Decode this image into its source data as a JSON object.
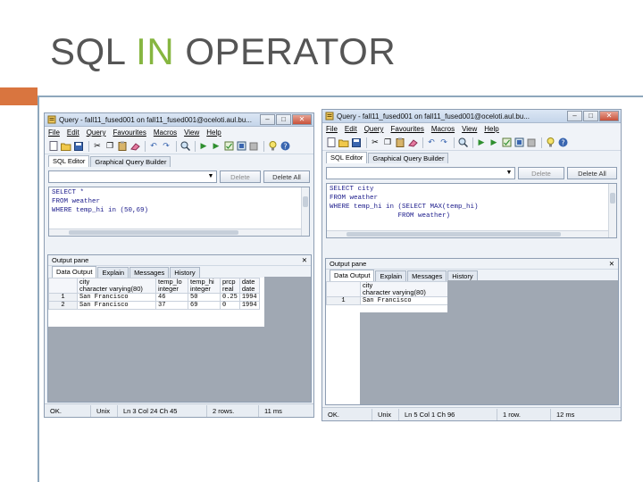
{
  "slide": {
    "title_part1": "SQL ",
    "title_accent": "IN",
    "title_part2": " OPERATOR",
    "accent_color": "#86b640",
    "text_color": "#555555",
    "rule_color": "#d9753f"
  },
  "windows": [
    {
      "title": "Query - fall11_fused001 on fall11_fused001@oceloti.aul.bu...",
      "menu": [
        "File",
        "Edit",
        "Query",
        "Favourites",
        "Macros",
        "View",
        "Help"
      ],
      "tabs": [
        "SQL Editor",
        "Graphical Query Builder"
      ],
      "buttons": {
        "delete": "Delete",
        "delete_all": "Delete All"
      },
      "sql": [
        "SELECT *",
        "FROM weather",
        "WHERE temp_hi in (50,69)"
      ],
      "output_title": "Output pane",
      "output_close": "✕",
      "output_tabs": [
        "Data Output",
        "Explain",
        "Messages",
        "History"
      ],
      "columns": [
        {
          "name": "city",
          "type": "character varying(80)"
        },
        {
          "name": "temp_lo",
          "type": "integer"
        },
        {
          "name": "temp_hi",
          "type": "integer"
        },
        {
          "name": "prcp",
          "type": "real"
        },
        {
          "name": "date",
          "type": "date"
        }
      ],
      "rows": [
        [
          "1",
          "San Francisco",
          "46",
          "50",
          "0.25",
          "1994"
        ],
        [
          "2",
          "San Francisco",
          "37",
          "69",
          "0",
          "1994"
        ]
      ],
      "status": [
        "OK.",
        "Unix",
        "Ln 3 Col 24 Ch 45",
        "2 rows.",
        "11 ms"
      ]
    },
    {
      "title": "Query - fall11_fused001 on fall11_fused001@oceloti.aul.bu...",
      "menu": [
        "File",
        "Edit",
        "Query",
        "Favourites",
        "Macros",
        "View",
        "Help"
      ],
      "tabs": [
        "SQL Editor",
        "Graphical Query Builder"
      ],
      "buttons": {
        "delete": "Delete",
        "delete_all": "Delete All"
      },
      "sql": [
        "SELECT city",
        "FROM weather",
        "WHERE temp_hi in (SELECT MAX(temp_hi)",
        "                 FROM weather)"
      ],
      "output_title": "Output pane",
      "output_close": "✕",
      "output_tabs": [
        "Data Output",
        "Explain",
        "Messages",
        "History"
      ],
      "columns": [
        {
          "name": "city",
          "type": "character varying(80)"
        }
      ],
      "rows": [
        [
          "1",
          "San Francisco"
        ]
      ],
      "status": [
        "OK.",
        "Unix",
        "Ln 5 Col 1 Ch 96",
        "1 row.",
        "12 ms"
      ]
    }
  ]
}
